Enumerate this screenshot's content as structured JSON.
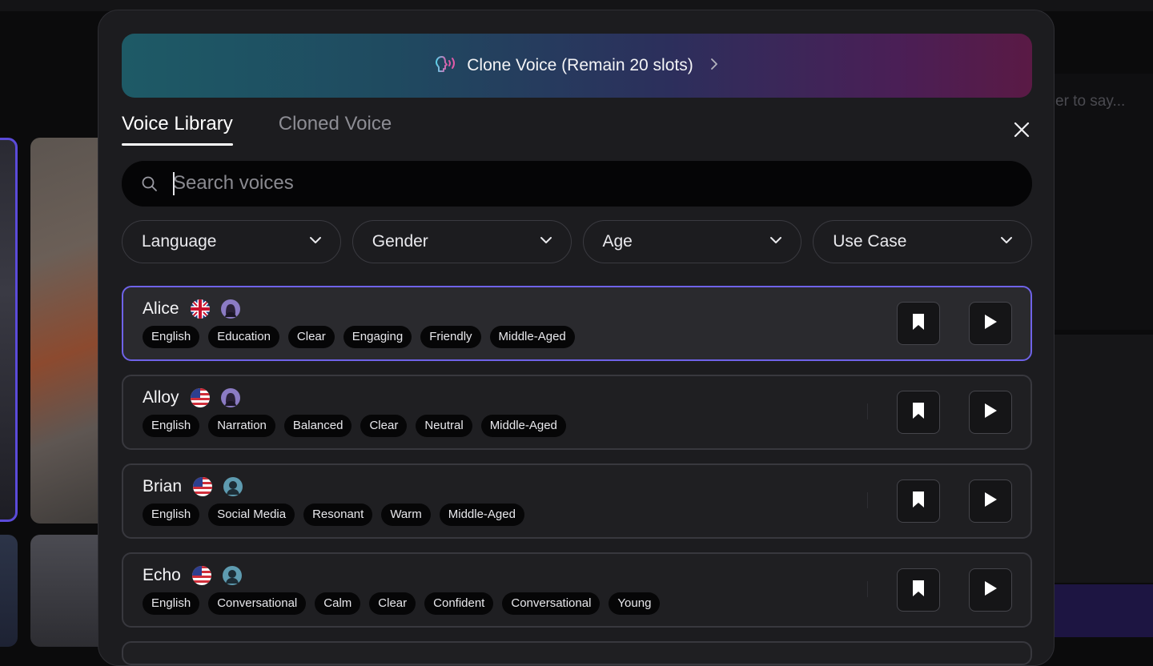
{
  "background": {
    "right_panel_text": "er to say..."
  },
  "clone_banner": {
    "label": "Clone Voice (Remain 20 slots)"
  },
  "tabs": [
    {
      "label": "Voice Library",
      "active": true
    },
    {
      "label": "Cloned Voice",
      "active": false
    }
  ],
  "search": {
    "placeholder": "Search voices",
    "value": ""
  },
  "filters": [
    {
      "label": "Language"
    },
    {
      "label": "Gender"
    },
    {
      "label": "Age"
    },
    {
      "label": "Use Case"
    }
  ],
  "voices": [
    {
      "name": "Alice",
      "flag": "uk-flag-icon",
      "avatar": "female-avatar-icon",
      "selected": true,
      "tags": [
        "English",
        "Education",
        "Clear",
        "Engaging",
        "Friendly",
        "Middle-Aged"
      ]
    },
    {
      "name": "Alloy",
      "flag": "us-flag-icon",
      "avatar": "female-avatar-icon",
      "selected": false,
      "tags": [
        "English",
        "Narration",
        "Balanced",
        "Clear",
        "Neutral",
        "Middle-Aged"
      ]
    },
    {
      "name": "Brian",
      "flag": "us-flag-icon",
      "avatar": "male-avatar-icon",
      "selected": false,
      "tags": [
        "English",
        "Social Media",
        "Resonant",
        "Warm",
        "Middle-Aged"
      ]
    },
    {
      "name": "Echo",
      "flag": "us-flag-icon",
      "avatar": "male-avatar-icon",
      "selected": false,
      "tags": [
        "English",
        "Conversational",
        "Calm",
        "Clear",
        "Confident",
        "Conversational",
        "Young"
      ]
    }
  ],
  "colors": {
    "accent": "#6f63e8",
    "modal_bg": "#1c1c1f",
    "tag_bg": "#060607"
  }
}
